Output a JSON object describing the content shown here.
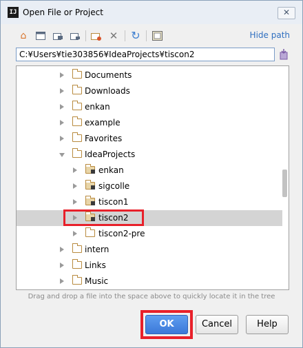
{
  "window": {
    "title": "Open File or Project",
    "close_symbol": "✕",
    "app_icon_text": "IJ"
  },
  "toolbar": {
    "icons": [
      "home-icon",
      "desktop-icon",
      "project-icon",
      "module-icon",
      "new-folder-icon",
      "delete-icon",
      "refresh-icon",
      "show-hidden-icon"
    ],
    "hide_path_label": "Hide path"
  },
  "path": {
    "value": "C:¥Users¥tie303856¥IdeaProjects¥tiscon2"
  },
  "tree": {
    "items": [
      {
        "label": "Documents",
        "expanded": false,
        "module": false
      },
      {
        "label": "Downloads",
        "expanded": false,
        "module": false
      },
      {
        "label": "enkan",
        "expanded": false,
        "module": false
      },
      {
        "label": "example",
        "expanded": false,
        "module": false
      },
      {
        "label": "Favorites",
        "expanded": false,
        "module": false
      },
      {
        "label": "IdeaProjects",
        "expanded": true,
        "module": false
      },
      {
        "label": "enkan",
        "expanded": false,
        "module": true
      },
      {
        "label": "sigcolle",
        "expanded": false,
        "module": true
      },
      {
        "label": "tiscon1",
        "expanded": false,
        "module": true
      },
      {
        "label": "tiscon2",
        "expanded": false,
        "module": true,
        "selected": true
      },
      {
        "label": "tiscon2-pre",
        "expanded": false,
        "module": false
      },
      {
        "label": "intern",
        "expanded": false,
        "module": false
      },
      {
        "label": "Links",
        "expanded": false,
        "module": false
      },
      {
        "label": "Music",
        "expanded": false,
        "module": false
      }
    ]
  },
  "hint": "Drag and drop a file into the space above to quickly locate it in the tree",
  "buttons": {
    "ok": "OK",
    "cancel": "Cancel",
    "help": "Help"
  },
  "colors": {
    "highlight": "#e8202a",
    "ok_button": "#3b78d8",
    "link": "#2f6fc0"
  }
}
